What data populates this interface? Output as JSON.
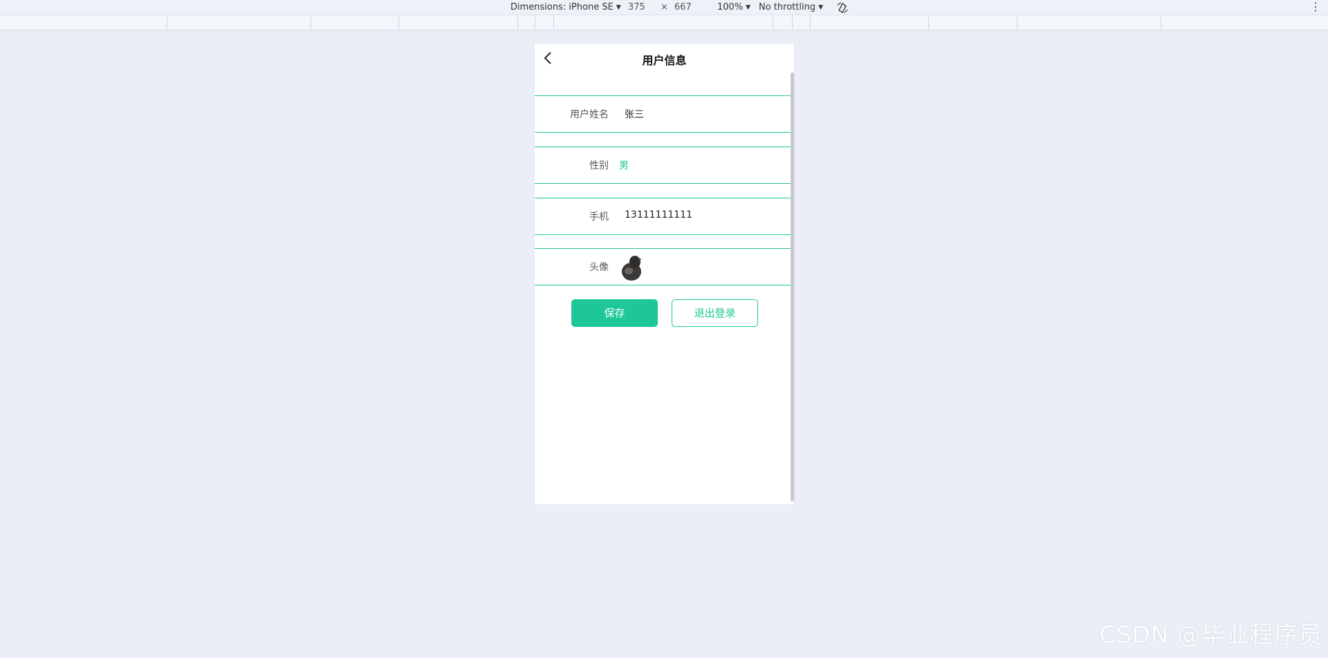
{
  "devtools": {
    "dimensions_label": "Dimensions: iPhone SE",
    "width": "375",
    "times": "×",
    "height": "667",
    "zoom": "100%",
    "throttling": "No throttling"
  },
  "page": {
    "title": "用户信息",
    "fields": [
      {
        "label": "用户姓名",
        "value": "张三"
      },
      {
        "label": "性别",
        "value": "男"
      },
      {
        "label": "手机",
        "value": "13111111111"
      },
      {
        "label": "头像",
        "value": ""
      }
    ],
    "save_label": "保存",
    "logout_label": "退出登录"
  },
  "watermark": "CSDN @毕业程序员",
  "colors": {
    "accent": "#1ec797",
    "background": "#eaeff7"
  }
}
